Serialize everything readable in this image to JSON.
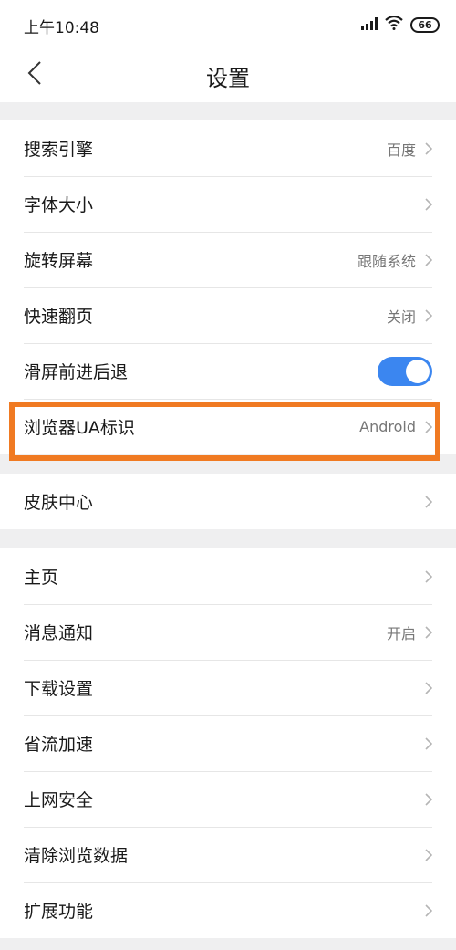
{
  "status": {
    "time": "上午10:48",
    "battery": "66"
  },
  "header": {
    "title": "设置"
  },
  "groups": [
    {
      "items": [
        {
          "label": "搜索引擎",
          "value": "百度"
        },
        {
          "label": "字体大小",
          "value": ""
        },
        {
          "label": "旋转屏幕",
          "value": "跟随系统"
        },
        {
          "label": "快速翻页",
          "value": "关闭"
        },
        {
          "label": "滑屏前进后退",
          "value": "",
          "toggle_on": true
        },
        {
          "label": "浏览器UA标识",
          "value": "Android",
          "highlighted": true
        }
      ]
    },
    {
      "items": [
        {
          "label": "皮肤中心",
          "value": ""
        }
      ]
    },
    {
      "items": [
        {
          "label": "主页",
          "value": ""
        },
        {
          "label": "消息通知",
          "value": "开启"
        },
        {
          "label": "下载设置",
          "value": ""
        },
        {
          "label": "省流加速",
          "value": ""
        },
        {
          "label": "上网安全",
          "value": ""
        },
        {
          "label": "清除浏览数据",
          "value": ""
        },
        {
          "label": "扩展功能",
          "value": ""
        }
      ]
    }
  ],
  "colors": {
    "accent": "#3b86f0",
    "highlight": "#f07a22",
    "background": "#efeff0"
  }
}
